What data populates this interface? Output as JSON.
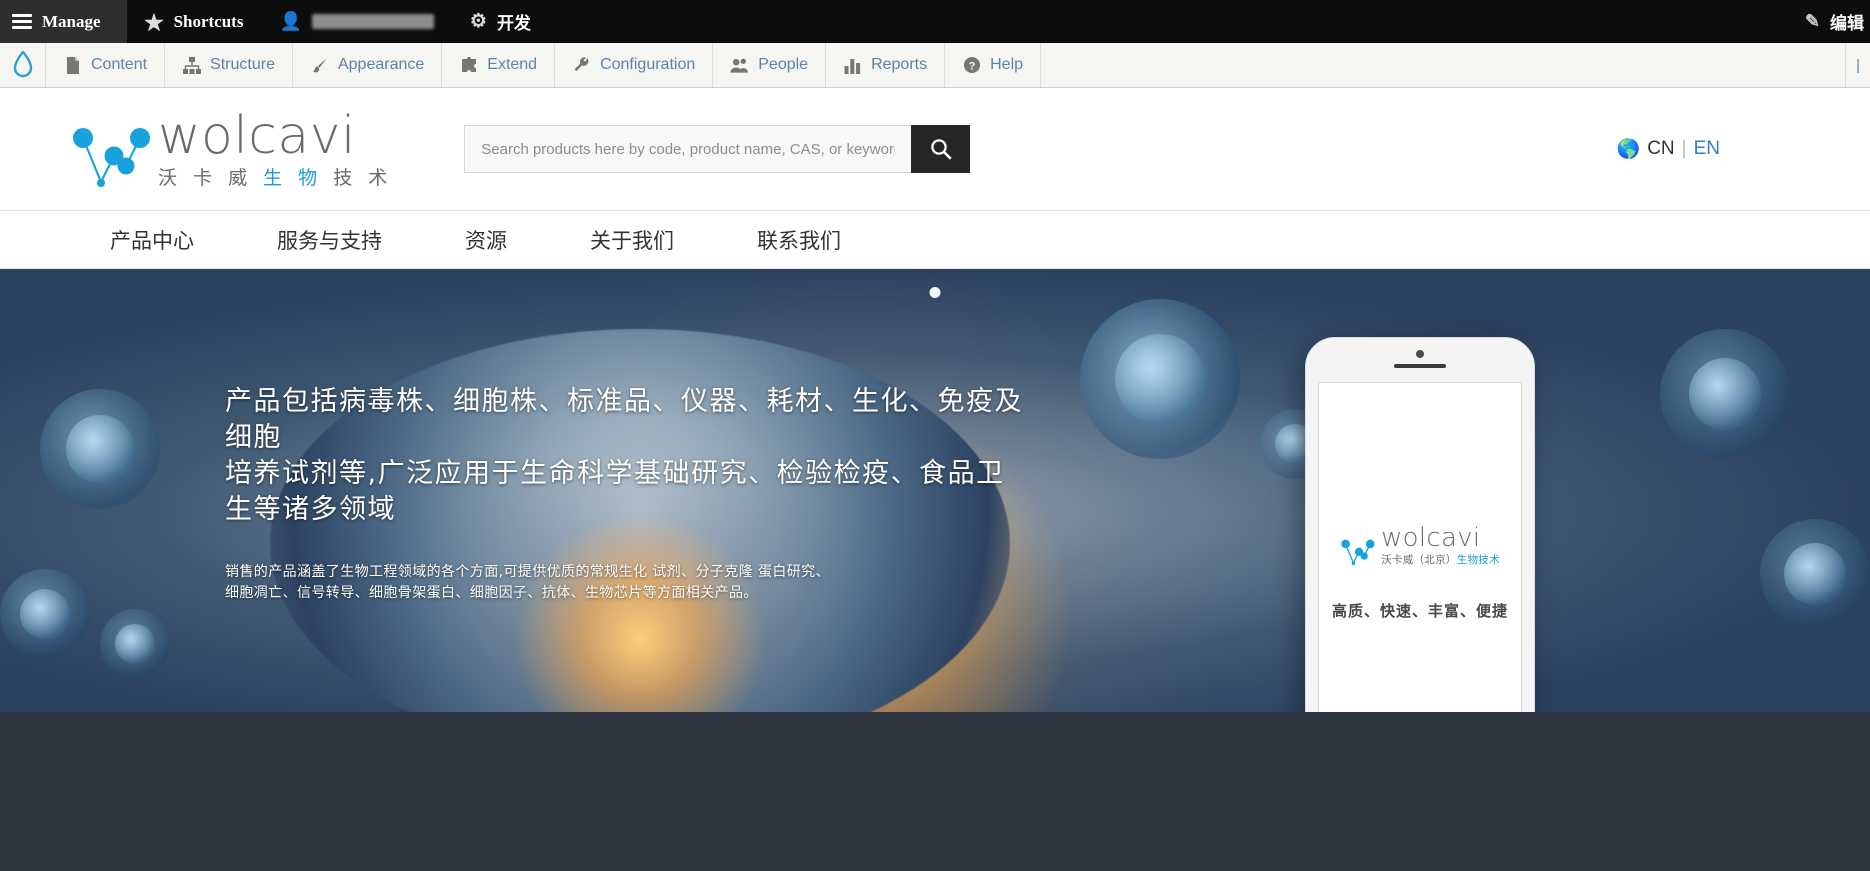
{
  "admin_toolbar": {
    "manage_label": "Manage",
    "shortcuts_label": "Shortcuts",
    "user_label": "",
    "dev_label": "开发",
    "edit_label": "编辑",
    "icons": {
      "hamburger": "hamburger-icon",
      "star": "star-icon",
      "user": "user-icon",
      "gear": "gear-icon",
      "pencil": "pencil-icon"
    }
  },
  "admin_menu": {
    "logo": "drupal-drop-icon",
    "items": [
      {
        "label": "Content",
        "icon": "file-icon"
      },
      {
        "label": "Structure",
        "icon": "sitemap-icon"
      },
      {
        "label": "Appearance",
        "icon": "paintbrush-icon"
      },
      {
        "label": "Extend",
        "icon": "puzzle-icon"
      },
      {
        "label": "Configuration",
        "icon": "wrench-icon"
      },
      {
        "label": "People",
        "icon": "people-icon"
      },
      {
        "label": "Reports",
        "icon": "bar-chart-icon"
      },
      {
        "label": "Help",
        "icon": "help-circle-icon"
      }
    ]
  },
  "site_header": {
    "brand": {
      "wordmark": "wolcavi",
      "sub_cn_1": "沃 卡 威 ",
      "sub_cn_highlight": "生 物 ",
      "sub_cn_2": "技 术",
      "mark": "wolcavi-network-logo"
    },
    "search": {
      "placeholder": "Search products here by code, product name, CAS, or keyword",
      "value": "",
      "button_icon": "search-icon"
    },
    "language": {
      "globe_icon": "globe-icon",
      "current": "CN",
      "separator": "|",
      "alternate": "EN"
    }
  },
  "main_nav": {
    "items": [
      {
        "label": "产品中心"
      },
      {
        "label": "服务与支持"
      },
      {
        "label": "资源"
      },
      {
        "label": "关于我们"
      },
      {
        "label": "联系我们"
      }
    ]
  },
  "hero": {
    "slide_indicator_count": 1,
    "title_line_1": "产品包括病毒株、细胞株、标准品、仪器、耗材、生化、免疫及细胞",
    "title_line_2": "培养试剂等,广泛应用于生命科学基础研究、检验检疫、食品卫生等诸多领域",
    "sub_line_1": "销售的产品涵盖了生物工程领域的各个方面,可提供优质的常规生化 试剂、分子克隆 蛋白研究、",
    "sub_line_2": "细胞凋亡、信号转导、细胞骨架蛋白、细胞因子、抗体、生物芯片等方面相关产品。",
    "phone": {
      "wordmark": "wolcavi",
      "sub_cn_1": "沃卡威（北京）",
      "sub_cn_highlight": "生物技术",
      "tagline": "高质、快速、丰富、便捷"
    }
  },
  "colors": {
    "brand_blue": "#1b9dd9",
    "admin_bar_bg": "#0d0d0d",
    "admin_menu_bg": "#f5f5f2",
    "admin_link": "#5a83aa",
    "search_button_bg": "#262626",
    "footer_bg": "#2e3540"
  }
}
